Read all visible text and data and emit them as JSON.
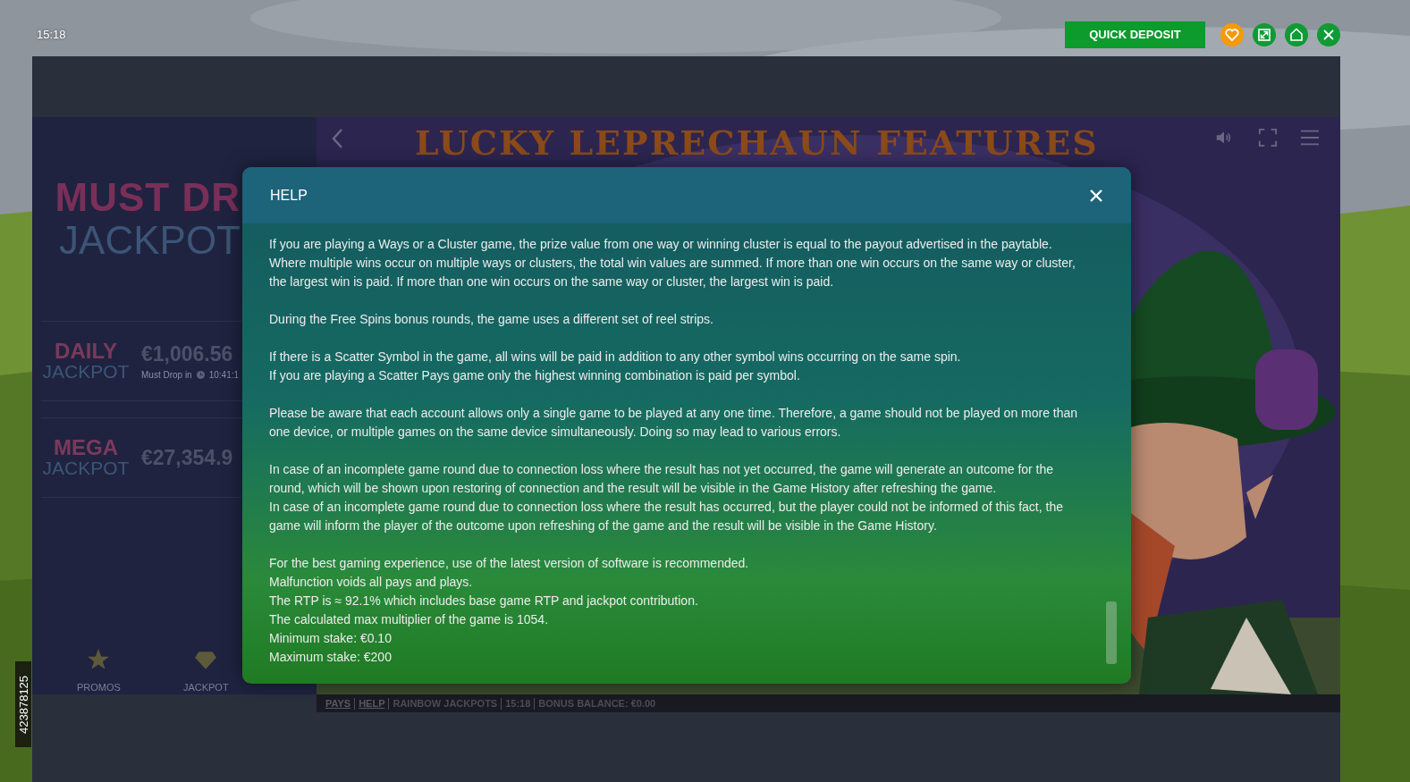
{
  "top_bar": {
    "time": "15:18",
    "quick_deposit": "QUICK DEPOSIT"
  },
  "side_id": "423878125",
  "jackpot_panel": {
    "logo_top": "MUST DR",
    "logo_bottom": "JACKPOT",
    "jackpots": [
      {
        "name_top": "DAILY",
        "name_bottom": "JACKPOT",
        "amount": "€1,006.56",
        "note": "Must Drop in",
        "timer": "10:41:1"
      },
      {
        "name_top": "MEGA",
        "name_bottom": "JACKPOT",
        "amount": "€27,354.9"
      }
    ],
    "nav": [
      {
        "label": "PROMOS",
        "kind": "star"
      },
      {
        "label": "JACKPOT",
        "kind": "gem"
      }
    ]
  },
  "game": {
    "title": "LUCKY LEPRECHAUN FEATURES"
  },
  "help": {
    "title": "HELP",
    "paragraphs": [
      [
        "If you are playing a Ways or a Cluster game, the prize value from one way or winning cluster is equal to the payout advertised in the paytable. Where multiple wins occur on multiple ways or clusters, the total win values are summed. If more than one win occurs on the same way or cluster, the largest win is paid. If more than one win occurs on the same way or cluster, the largest win is paid."
      ],
      [
        "During the Free Spins bonus rounds, the game uses a different set of reel strips."
      ],
      [
        "If there is a Scatter Symbol in the game, all wins will be paid in addition to any other symbol wins occurring on the same spin.",
        "If you are playing a Scatter Pays game only the highest winning combination is paid per symbol."
      ],
      [
        "Please be aware that each account allows only a single game to be played at any one time. Therefore, a game should not be played on more than one device, or multiple games on the same device simultaneously. Doing so may lead to various errors."
      ],
      [
        "In case of an incomplete game round due to connection loss where the result has not yet occurred, the game will generate an outcome for the round, which will be shown upon restoring of connection and the result will be visible in the Game History after refreshing the game.",
        "In case of an incomplete game round due to connection loss where the result has occurred, but the player could not be informed of this fact, the game will inform the player of the outcome upon refreshing of the game and the result will be visible in the Game History."
      ],
      [
        "For the best gaming experience, use of the latest version of software is recommended.",
        "Malfunction voids all pays and plays.",
        "The RTP is ≈ 92.1% which includes base game RTP and jackpot contribution.",
        "The calculated max multiplier of the game is 1054.",
        "Minimum stake: €0.10",
        "Maximum stake: €200"
      ]
    ]
  },
  "status_bar": [
    {
      "label": "PAYS",
      "kind": "link"
    },
    {
      "label": "HELP",
      "kind": "link"
    },
    {
      "label": "RAINBOW JACKPOTS",
      "kind": "text"
    },
    {
      "label": "15:18",
      "kind": "text"
    },
    {
      "label": "BONUS BALANCE: €0.00",
      "kind": "text"
    }
  ]
}
